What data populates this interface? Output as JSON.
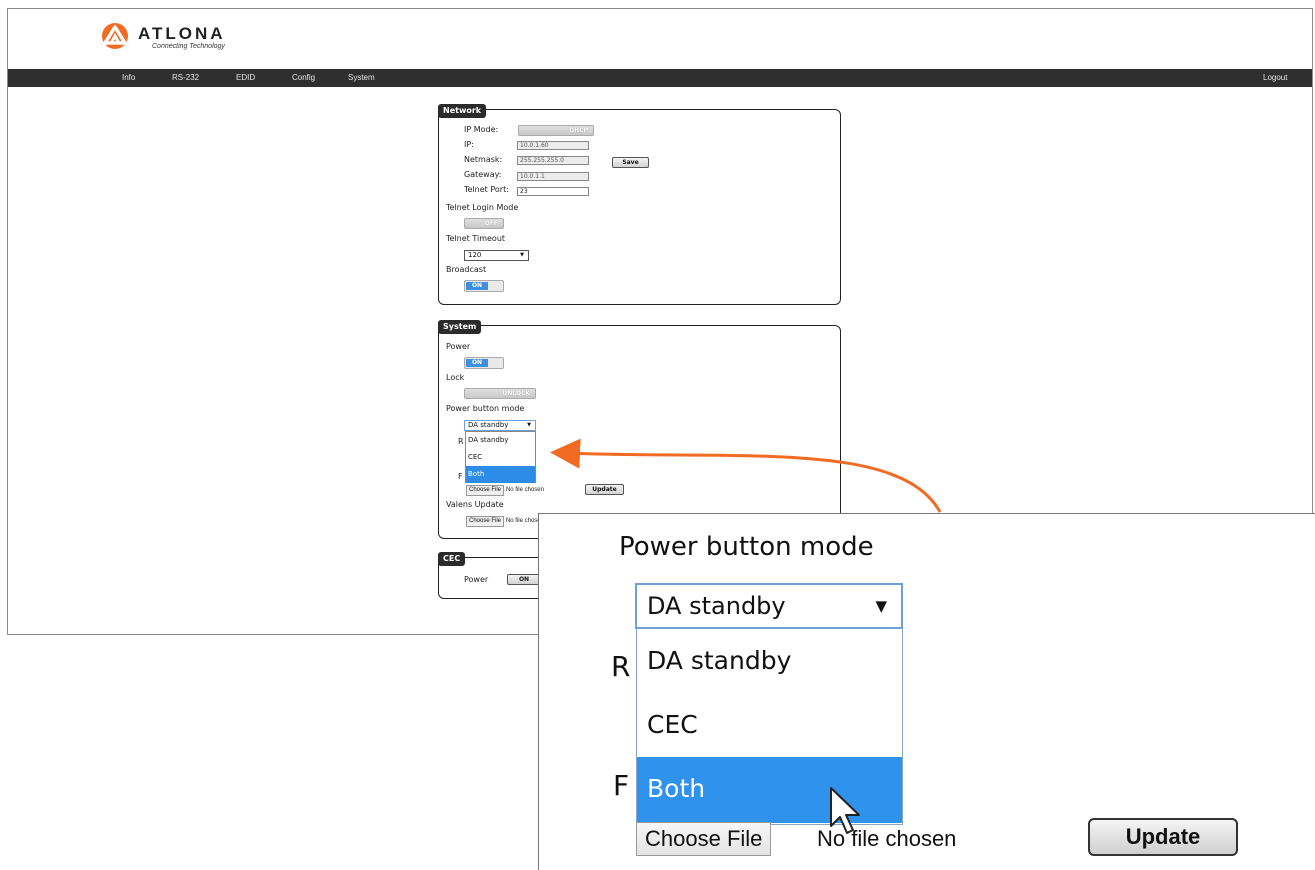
{
  "header": {
    "brand": "ATLONA",
    "tagline": "Connecting Technology"
  },
  "nav": {
    "items": [
      "Info",
      "RS-232",
      "EDID",
      "Config",
      "System"
    ],
    "logout": "Logout"
  },
  "network": {
    "title": "Network",
    "ip_mode_label": "IP Mode:",
    "ip_mode_value": "DHCP",
    "ip_label": "IP:",
    "ip_value": "10.0.1.60",
    "netmask_label": "Netmask:",
    "netmask_value": "255.255.255.0",
    "gateway_label": "Gateway:",
    "gateway_value": "10.0.1.1",
    "telnet_port_label": "Telnet Port:",
    "telnet_port_value": "23",
    "save_label": "Save",
    "telnet_login_mode_label": "Telnet Login Mode",
    "telnet_login_mode_value": "OFF",
    "telnet_timeout_label": "Telnet Timeout",
    "telnet_timeout_value": "120",
    "broadcast_label": "Broadcast",
    "broadcast_value": "ON"
  },
  "system": {
    "title": "System",
    "power_label": "Power",
    "power_value": "ON",
    "lock_label": "Lock",
    "lock_value": "UNLOCK",
    "power_button_mode_label": "Power button mode",
    "power_button_mode_value": "DA standby",
    "power_button_mode_options": [
      "DA standby",
      "CEC",
      "Both"
    ],
    "clipped_r": "R",
    "clipped_f": "F",
    "choose_file_label": "Choose File",
    "no_file_label": "No file chosen",
    "update_label": "Update",
    "valens_update_label": "Valens Update"
  },
  "cec": {
    "title": "CEC",
    "power_label": "Power",
    "power_value": "ON"
  },
  "colors": {
    "accent": "#f26b22",
    "selected": "#2d8de6",
    "navbar": "#2f2f2f"
  }
}
